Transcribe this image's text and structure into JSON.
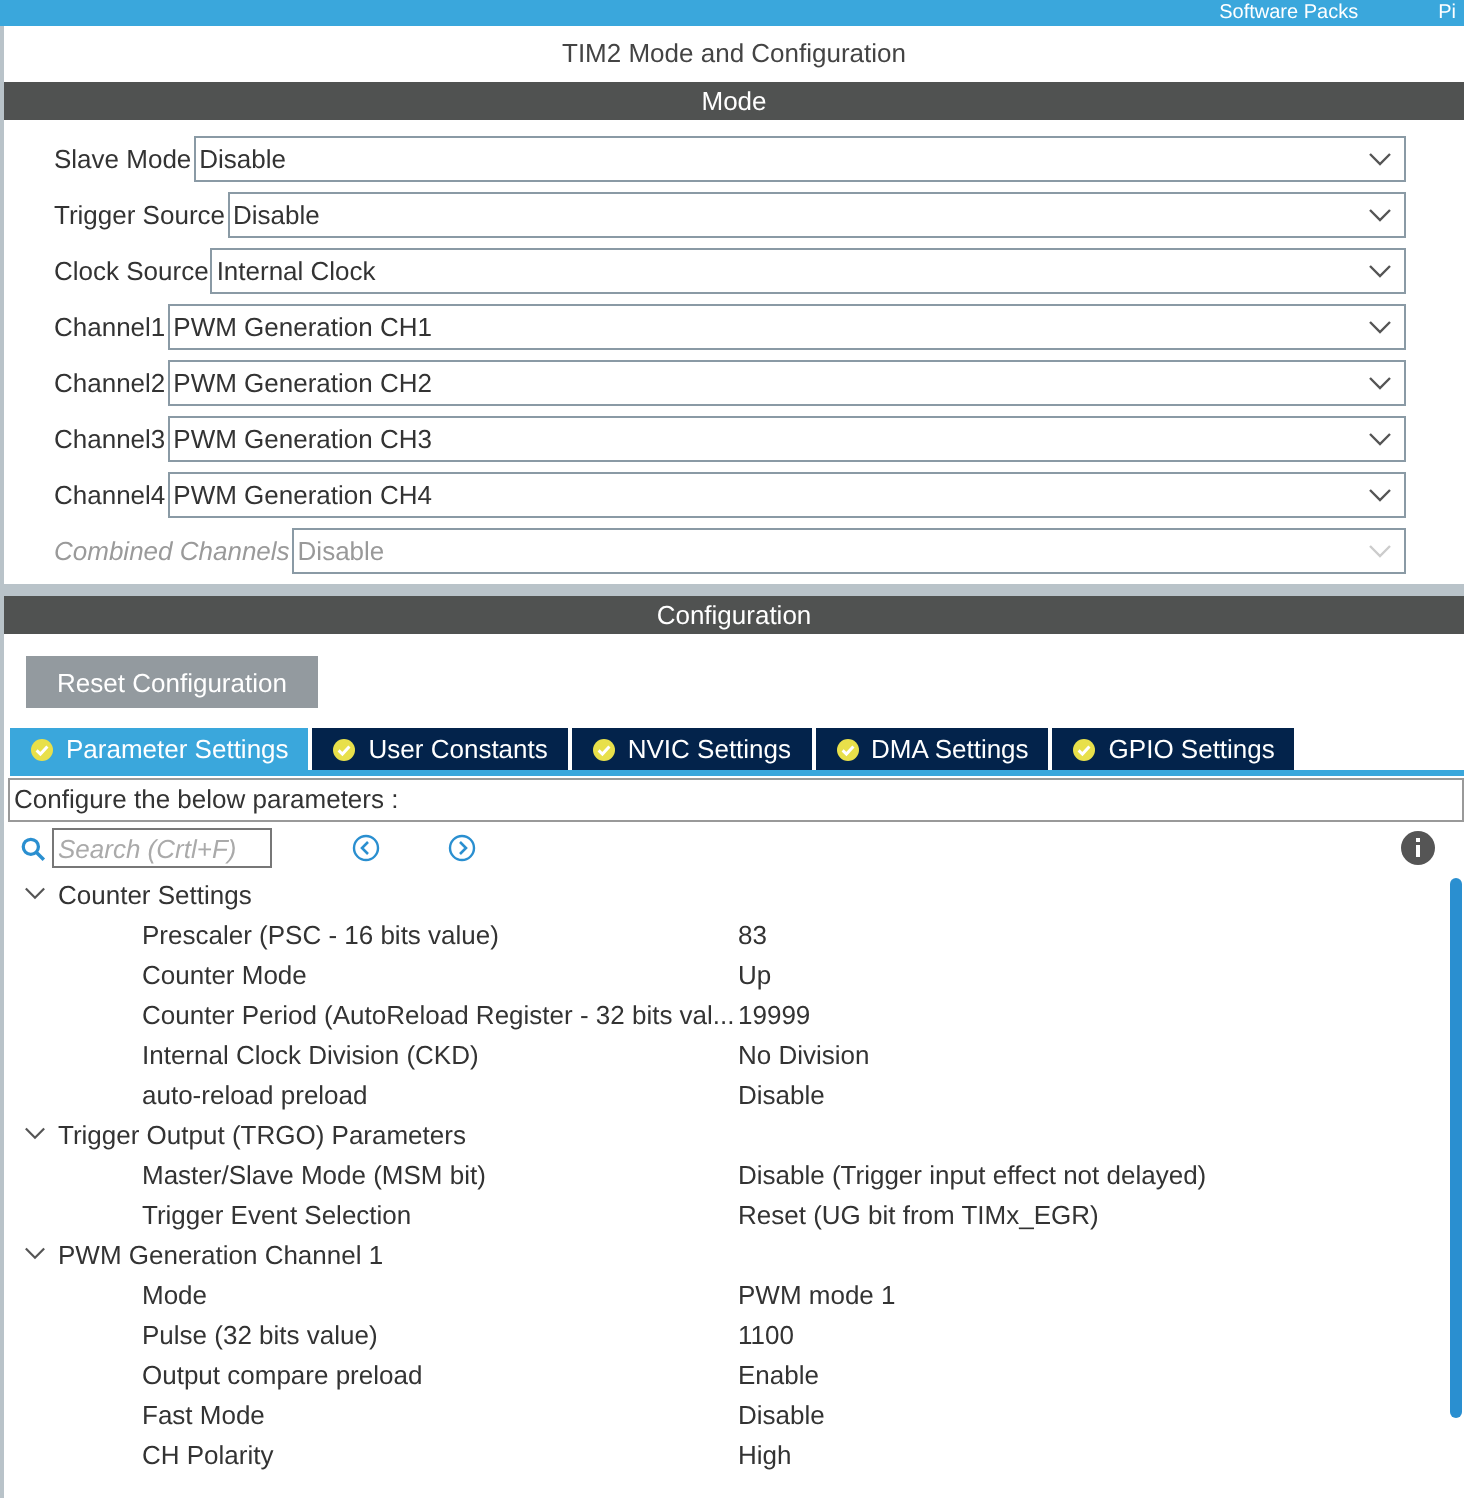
{
  "top_bar": {
    "items": [
      "Software Packs",
      "Pi"
    ]
  },
  "window": {
    "title": "TIM2 Mode and Configuration"
  },
  "mode": {
    "header": "Mode",
    "fields": [
      {
        "label": "Slave Mode",
        "value": "Disable",
        "disabled": false
      },
      {
        "label": "Trigger Source",
        "value": "Disable",
        "disabled": false
      },
      {
        "label": "Clock Source",
        "value": "Internal Clock",
        "disabled": false
      },
      {
        "label": "Channel1",
        "value": "PWM Generation CH1",
        "disabled": false
      },
      {
        "label": "Channel2",
        "value": "PWM Generation CH2",
        "disabled": false
      },
      {
        "label": "Channel3",
        "value": "PWM Generation CH3",
        "disabled": false
      },
      {
        "label": "Channel4",
        "value": "PWM Generation CH4",
        "disabled": false
      },
      {
        "label": "Combined Channels",
        "value": "Disable",
        "disabled": true
      }
    ]
  },
  "configuration": {
    "header": "Configuration",
    "reset_button": "Reset Configuration",
    "tabs": [
      {
        "label": "Parameter Settings",
        "selected": true
      },
      {
        "label": "User Constants",
        "selected": false
      },
      {
        "label": "NVIC Settings",
        "selected": false
      },
      {
        "label": "DMA Settings",
        "selected": false
      },
      {
        "label": "GPIO Settings",
        "selected": false
      }
    ],
    "hint": "Configure the below parameters :",
    "search": {
      "placeholder": "Search (Crtl+F)"
    },
    "tree": [
      {
        "name": "Counter Settings",
        "expanded": true,
        "children": [
          {
            "name": "Prescaler (PSC - 16 bits value)",
            "value": "83"
          },
          {
            "name": "Counter Mode",
            "value": "Up"
          },
          {
            "name": "Counter Period (AutoReload Register - 32 bits val...",
            "value": "19999"
          },
          {
            "name": "Internal Clock Division (CKD)",
            "value": "No Division"
          },
          {
            "name": "auto-reload preload",
            "value": "Disable"
          }
        ]
      },
      {
        "name": "Trigger Output (TRGO) Parameters",
        "expanded": true,
        "children": [
          {
            "name": "Master/Slave Mode (MSM bit)",
            "value": "Disable (Trigger input effect not delayed)"
          },
          {
            "name": "Trigger Event Selection",
            "value": "Reset (UG bit from TIMx_EGR)"
          }
        ]
      },
      {
        "name": "PWM Generation Channel 1",
        "expanded": true,
        "children": [
          {
            "name": "Mode",
            "value": "PWM mode 1"
          },
          {
            "name": "Pulse (32 bits value)",
            "value": "1100"
          },
          {
            "name": "Output compare preload",
            "value": "Enable"
          },
          {
            "name": "Fast Mode",
            "value": "Disable"
          },
          {
            "name": "CH Polarity",
            "value": "High"
          }
        ]
      }
    ]
  }
}
